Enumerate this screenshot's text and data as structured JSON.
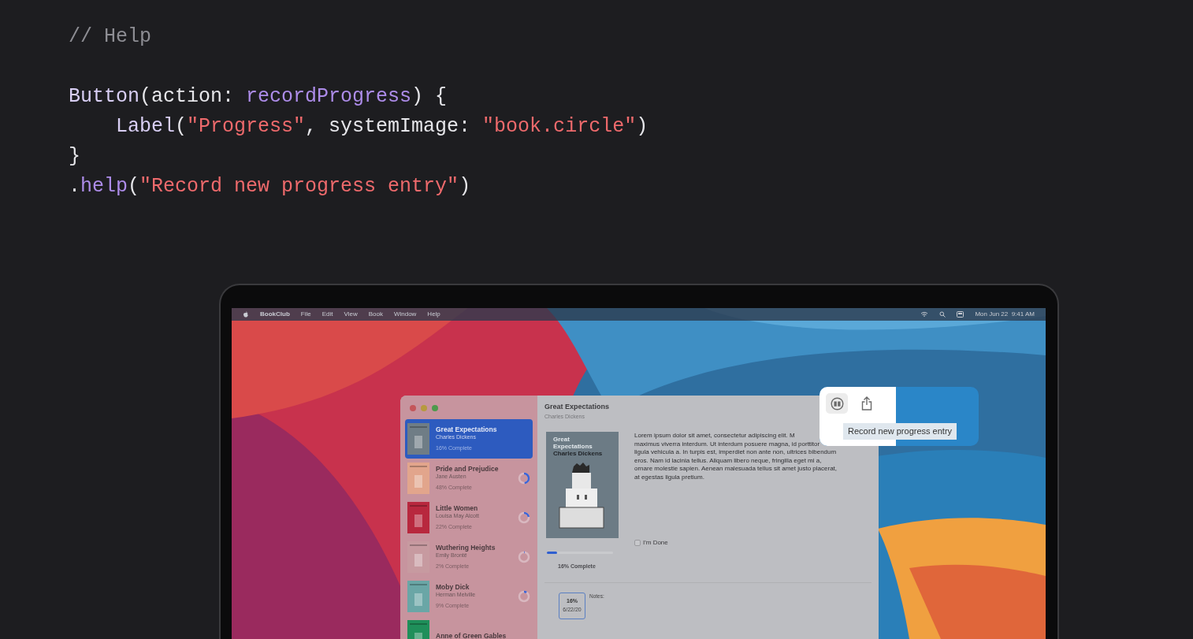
{
  "code": {
    "comment": "// Help",
    "lines": [
      [
        {
          "kind": "type",
          "text": "Button"
        },
        {
          "kind": "plain",
          "text": "(action: "
        },
        {
          "kind": "member",
          "text": "recordProgress"
        },
        {
          "kind": "plain",
          "text": ") {"
        }
      ],
      [
        {
          "kind": "type",
          "text": "Label"
        },
        {
          "kind": "plain",
          "text": "("
        },
        {
          "kind": "string",
          "text": "\"Progress\""
        },
        {
          "kind": "plain",
          "text": ", systemImage: "
        },
        {
          "kind": "string",
          "text": "\"book.circle\""
        },
        {
          "kind": "plain",
          "text": ")"
        }
      ],
      [
        {
          "kind": "plain",
          "text": "}"
        }
      ],
      [
        {
          "kind": "plain",
          "text": "."
        },
        {
          "kind": "member",
          "text": "help"
        },
        {
          "kind": "plain",
          "text": "("
        },
        {
          "kind": "string",
          "text": "\"Record new progress entry\""
        },
        {
          "kind": "plain",
          "text": ")"
        }
      ]
    ]
  },
  "menu_bar": {
    "app": "BookClub",
    "menus": [
      "File",
      "Edit",
      "View",
      "Book",
      "Window",
      "Help"
    ],
    "clock": "Mon Jun 22  9:41 AM"
  },
  "books": [
    {
      "title": "Great Expectations",
      "author": "Charles Dickens",
      "progress": "16% Complete",
      "selected": true,
      "color": "#6f7d86"
    },
    {
      "title": "Pride and Prejudice",
      "author": "Jane Austen",
      "progress": "48% Complete",
      "level": 0.48,
      "selected": false,
      "color": "#e2a58c"
    },
    {
      "title": "Little Women",
      "author": "Louisa May Alcott",
      "progress": "22% Complete",
      "level": 0.22,
      "selected": false,
      "color": "#b8283e"
    },
    {
      "title": "Wuthering Heights",
      "author": "Emily Brontë",
      "progress": "2% Complete",
      "level": 0.02,
      "selected": false,
      "color": "#c79aa0"
    },
    {
      "title": "Moby Dick",
      "author": "Herman Melville",
      "progress": "9% Complete",
      "level": 0.09,
      "selected": false,
      "color": "#6aa6a6"
    },
    {
      "title": "Anne of Green Gables",
      "selected": false,
      "color": "#1f8f5a"
    }
  ],
  "detail": {
    "title": "Great Expectations",
    "author": "Charles Dickens",
    "cover": {
      "title": "Great Expectations",
      "author": "Charles Dickens"
    },
    "description_lines": [
      "Lorem ipsum dolor sit amet, consectetur adipiscing elit. M",
      "maximus viverra interdum. Ut interdum posuere magna, id porttitor",
      "ligula vehicula a. In turpis est, imperdiet non ante non, ultrices bibendum",
      "eros. Nam id lacinia tellus. Aliquam libero neque, fringilla eget mi a,",
      "ornare molestie sapien. Aenean malesuada tellus sit amet justo placerat,",
      "at egestas ligula pretium."
    ],
    "done": {
      "label": "I'm Done",
      "checked": false
    },
    "progress": {
      "level": 0.16,
      "label": "16% Complete"
    },
    "entries": [
      {
        "percent": "16%",
        "date": "6/22/20"
      }
    ],
    "notes_label": "Notes:"
  },
  "toolbar_zoom": {
    "tooltip": "Record new progress entry",
    "buttons": [
      {
        "kind": "progress",
        "selected": true
      },
      {
        "kind": "share",
        "selected": false
      }
    ]
  }
}
